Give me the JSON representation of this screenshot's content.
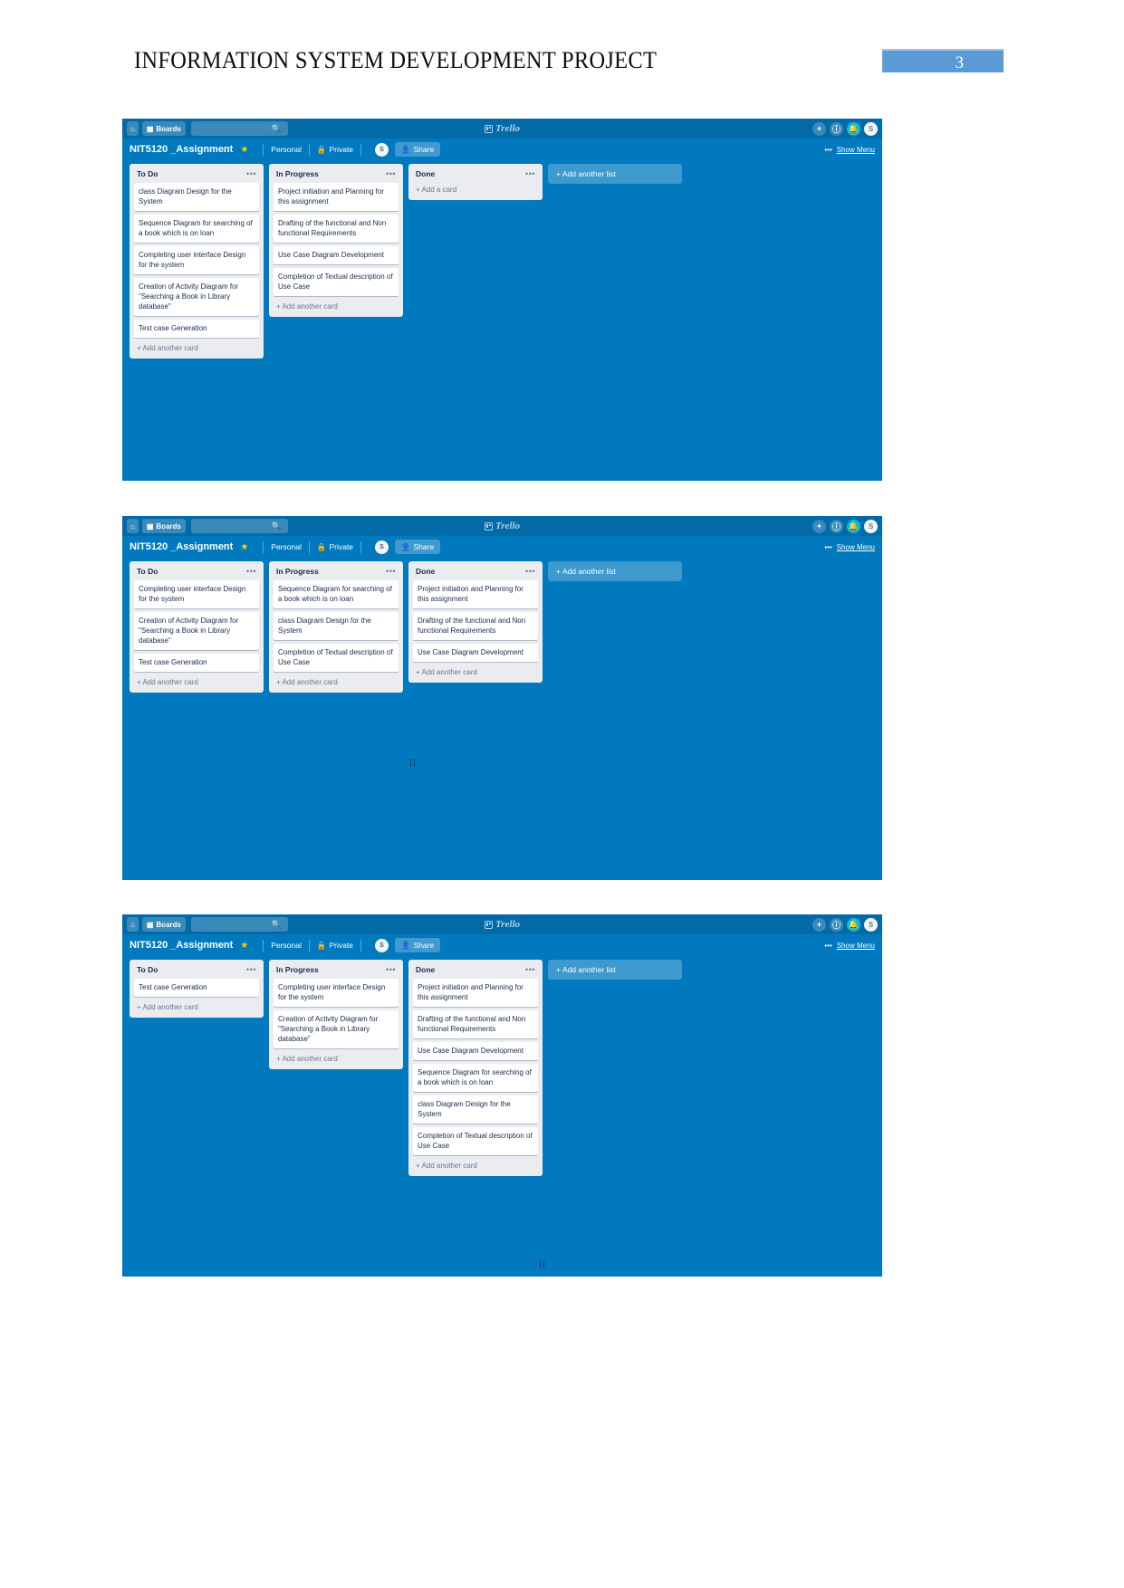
{
  "document": {
    "title": "INFORMATION SYSTEM DEVELOPMENT PROJECT",
    "page_number": "3"
  },
  "nav": {
    "home_icon": "home-icon",
    "boards_label": "Boards",
    "boards_icon": "board-icon",
    "search_placeholder": "",
    "search_value": "",
    "search_icon": "search-icon",
    "logo_text": "Trello",
    "add_icon": "+",
    "info_icon": "i",
    "bell_icon": "⚑",
    "avatar_label": "S"
  },
  "board_header": {
    "title": "NIT5120 _Assignment",
    "star_icon": "★",
    "team_label": "Personal",
    "visibility_label": "Private",
    "visibility_icon": "lock-icon",
    "member_avatar": "S",
    "share_label": "Share",
    "share_icon": "person-add-icon",
    "menu_label": "Show Menu",
    "menu_dots": "•••"
  },
  "common": {
    "add_another_card": "+ Add another card",
    "add_a_card": "+ Add a card",
    "add_another_list": "+ Add another list",
    "list_dots": "•••"
  },
  "colors": {
    "board_background": "#0079bf",
    "nav_background": "#026aa7",
    "list_background": "#ebecf0",
    "card_background": "#ffffff",
    "accent_badge": "#5b9bd5",
    "bell_accent": "#00c2e0"
  },
  "boards": [
    {
      "id": "board-1",
      "lists": [
        {
          "title": "To Do",
          "cards": [
            "class Diagram Design for the System",
            "Sequence Diagram for searching of a book which is on loan",
            "Completing user interface Design for the system",
            "Creation of Activity Diagram for \"Searching a Book in Library database\"",
            "Test case Generation"
          ],
          "footer": "+ Add another card"
        },
        {
          "title": "In Progress",
          "cards": [
            "Project initiation and Planning for this assignment",
            "Drafting of the functional and Non functional Requirements",
            "Use Case Diagram Development",
            "Completion of Textual description of Use Case"
          ],
          "footer": "+ Add another card"
        },
        {
          "title": "Done",
          "cards": [],
          "footer": "+ Add a card"
        }
      ]
    },
    {
      "id": "board-2",
      "lists": [
        {
          "title": "To Do",
          "cards": [
            "Completing user interface Design for the system",
            "Creation of Activity Diagram for \"Searching a Book in Library database\"",
            "Test case Generation"
          ],
          "footer": "+ Add another card"
        },
        {
          "title": "In Progress",
          "cards": [
            "Sequence Diagram for searching of a book which is on loan",
            "class Diagram Design for the System",
            "Completion of Textual description of Use Case"
          ],
          "footer": "+ Add another card"
        },
        {
          "title": "Done",
          "cards": [
            "Project initiation and Planning for this assignment",
            "Drafting of the functional and Non functional Requirements",
            "Use Case Diagram Development"
          ],
          "footer": "+ Add another card"
        }
      ]
    },
    {
      "id": "board-3",
      "lists": [
        {
          "title": "To Do",
          "cards": [
            "Test case Generation"
          ],
          "footer": "+ Add another card"
        },
        {
          "title": "In Progress",
          "cards": [
            "Completing user interface Design for the system",
            "Creation of Activity Diagram for \"Searching a Book in Library database\""
          ],
          "footer": "+ Add another card"
        },
        {
          "title": "Done",
          "cards": [
            "Project initiation and Planning for this assignment",
            "Drafting of the functional and Non functional Requirements",
            "Use Case Diagram Development",
            "Sequence Diagram for searching of a book which is on loan",
            "class Diagram Design for the System",
            "Completion of Textual description of Use Case"
          ],
          "footer": "+ Add another card"
        }
      ]
    }
  ]
}
